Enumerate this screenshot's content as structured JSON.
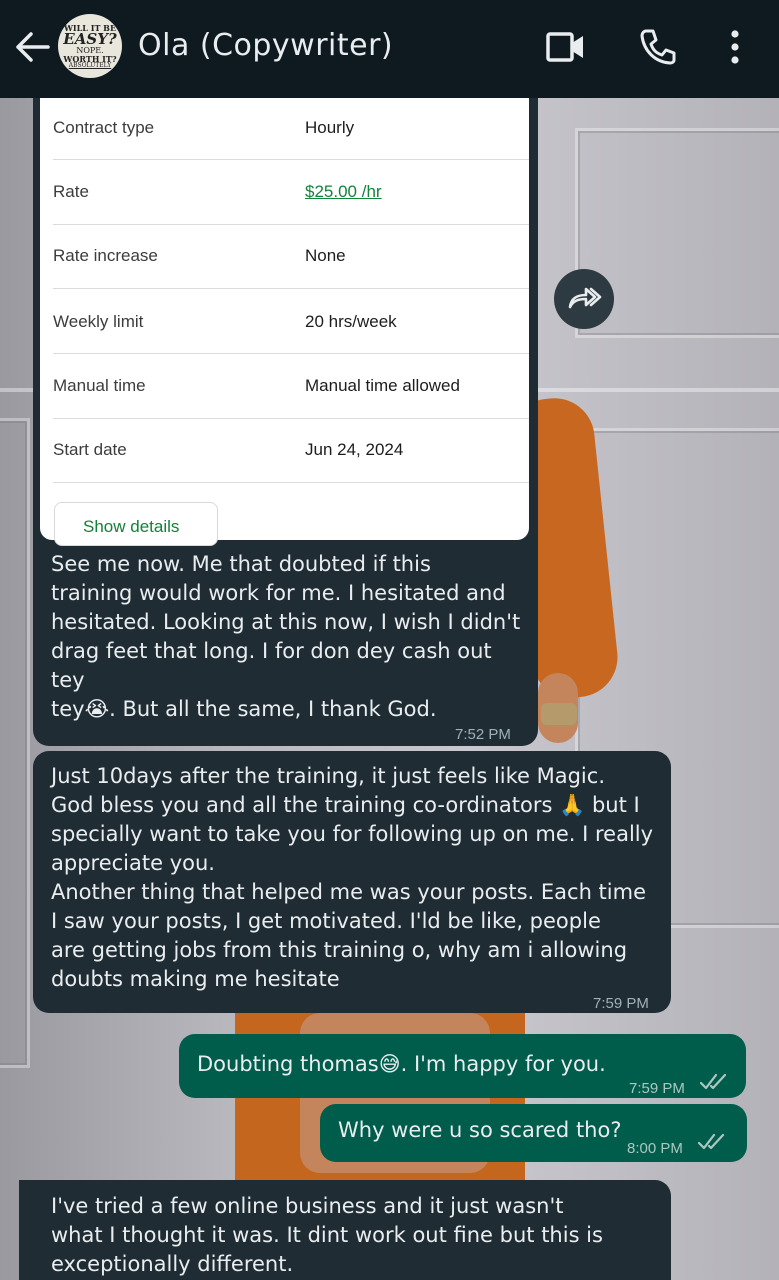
{
  "header": {
    "contact_name": "Ola (Copywriter)",
    "avatar_text": {
      "line1": "WILL IT BE",
      "line2": "EASY?",
      "line3": "NOPE.",
      "line4": "WORTH IT?",
      "line5": "ABSOLUTELY"
    },
    "icons": [
      "back-arrow-icon",
      "video-call-icon",
      "phone-icon",
      "more-vert-icon"
    ]
  },
  "contract_card": {
    "rows": [
      {
        "label": "Contract type",
        "value": "Hourly"
      },
      {
        "label": "Rate",
        "value": "$25.00 /hr"
      },
      {
        "label": "Rate increase",
        "value": "None"
      },
      {
        "label": "Weekly limit",
        "value": "20 hrs/week"
      },
      {
        "label": "Manual time",
        "value": "Manual time allowed"
      },
      {
        "label": "Start date",
        "value": "Jun 24, 2024"
      }
    ],
    "show_details_label": "Show details"
  },
  "messages": [
    {
      "direction": "in",
      "text": "See me now. Me that doubted if this\ntraining would work for me. I hesitated and\nhesitated. Looking at this now, I wish I didn't\ndrag feet that long. I for don dey cash out tey\ntey😭. But all the same, I thank God.",
      "time": "7:52 PM"
    },
    {
      "direction": "in",
      "text": "Just 10days after the training, it just feels like Magic.\nGod bless you and all the training co-ordinators 🙏 but I\nspecially want to take you for following up on me. I really\nappreciate you.\nAnother thing that helped me was your posts. Each time\nI saw your posts, I get motivated. I'ld be like, people\nare getting jobs from this training o, why am i allowing\ndoubts making me hesitate",
      "time": "7:59 PM"
    },
    {
      "direction": "out",
      "text": "Doubting thomas😅. I'm happy for you.",
      "time": "7:59 PM",
      "status": "read"
    },
    {
      "direction": "out",
      "text": "Why were u so scared tho?",
      "time": "8:00 PM",
      "status": "read"
    },
    {
      "direction": "in",
      "text": "I've tried a few online business and it just wasn't\nwhat I thought it was. It dint work out fine but this is\nexceptionally different.",
      "time": ""
    }
  ],
  "colors": {
    "header_bg": "#0f1a20",
    "incoming_bubble": "#1f2c34",
    "outgoing_bubble": "#005c4b",
    "link_green": "#14843a",
    "read_ticks": "#aec8c1"
  }
}
